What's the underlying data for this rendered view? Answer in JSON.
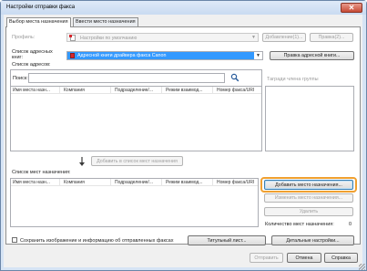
{
  "window": {
    "title": "Настройки отправки факса",
    "close_glyph": "✕"
  },
  "tabs": [
    {
      "label": "Выбор места назначения"
    },
    {
      "label": "Ввести место назначения"
    }
  ],
  "profile": {
    "label": "Профиль:",
    "value": "Настройки по умолчанию",
    "add_button": "Добавление(1)...",
    "edit_button": "Правка(2)..."
  },
  "address_book": {
    "label": "Список адресных книг:",
    "value": "Адресной книги драйвера факса Canon",
    "edit_button": "Правка адресной книги..."
  },
  "address_list": {
    "label": "Список адресов:",
    "search_label": "Поиск:",
    "search_value": "",
    "group_label": "Тагради члена группы"
  },
  "address_columns": [
    "Имя места назн...",
    "Компания",
    "Подразделение/...",
    "Режим взаимод...",
    "Номер факса/URI"
  ],
  "add_to_dest_button": "Добавить в список мест назначения",
  "dest_list": {
    "label": "Список мест назначения:",
    "count_label": "Количество мест назначения:",
    "count_value": "0"
  },
  "dest_columns": [
    "Имя места назн...",
    "Компания",
    "Подразделение/...",
    "Режим взаимод...",
    "Номер факса/URI"
  ],
  "dest_buttons": {
    "add": "Добавить место назначения...",
    "edit": "Изменить место назначения...",
    "delete": "Удалить"
  },
  "save_image_checkbox": "Сохранить изображение и информацию об отправленных факсах",
  "cover_button": "Титульный лист...",
  "detail_button": "Детальные настройки...",
  "footer": {
    "send": "Отправить",
    "cancel": "Отмена",
    "help": "Справка"
  },
  "colors": {
    "highlight": "#f0a030",
    "titlebar": "#d6e4f5",
    "flag": "#d7262c"
  }
}
